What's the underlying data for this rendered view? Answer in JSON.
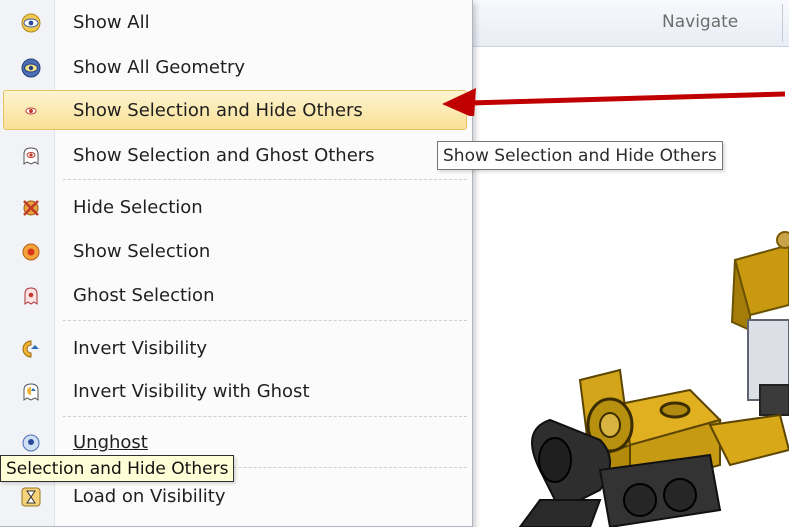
{
  "ribbon": {
    "tab_label": "Navigate"
  },
  "menu": {
    "items": [
      {
        "label": "Show All",
        "icon": "eye-icon"
      },
      {
        "label": "Show All Geometry",
        "icon": "eye-geometry-icon"
      },
      {
        "label": "Show Selection and Hide Others",
        "icon": "show-selection-hide-others-icon",
        "highlighted": true
      },
      {
        "label": "Show Selection and Ghost Others",
        "icon": "ghost-others-icon"
      },
      {
        "label": "Hide Selection",
        "icon": "hide-selection-icon"
      },
      {
        "label": "Show Selection",
        "icon": "show-selection-icon"
      },
      {
        "label": "Ghost Selection",
        "icon": "ghost-selection-icon"
      },
      {
        "label": "Invert Visibility",
        "icon": "invert-visibility-icon"
      },
      {
        "label": "Invert Visibility with Ghost",
        "icon": "invert-visibility-ghost-icon"
      },
      {
        "label": "Unghost",
        "icon": "unghost-icon"
      },
      {
        "label": "Load on Visibility",
        "icon": "hourglass-icon"
      }
    ]
  },
  "tooltips": {
    "right": "Show Selection and Hide Others",
    "left": "Selection and Hide Others"
  },
  "colors": {
    "highlight": "#f9e096",
    "arrow": "#c00000",
    "model_gold": "#d4a017",
    "model_dark": "#2b2b2b"
  }
}
